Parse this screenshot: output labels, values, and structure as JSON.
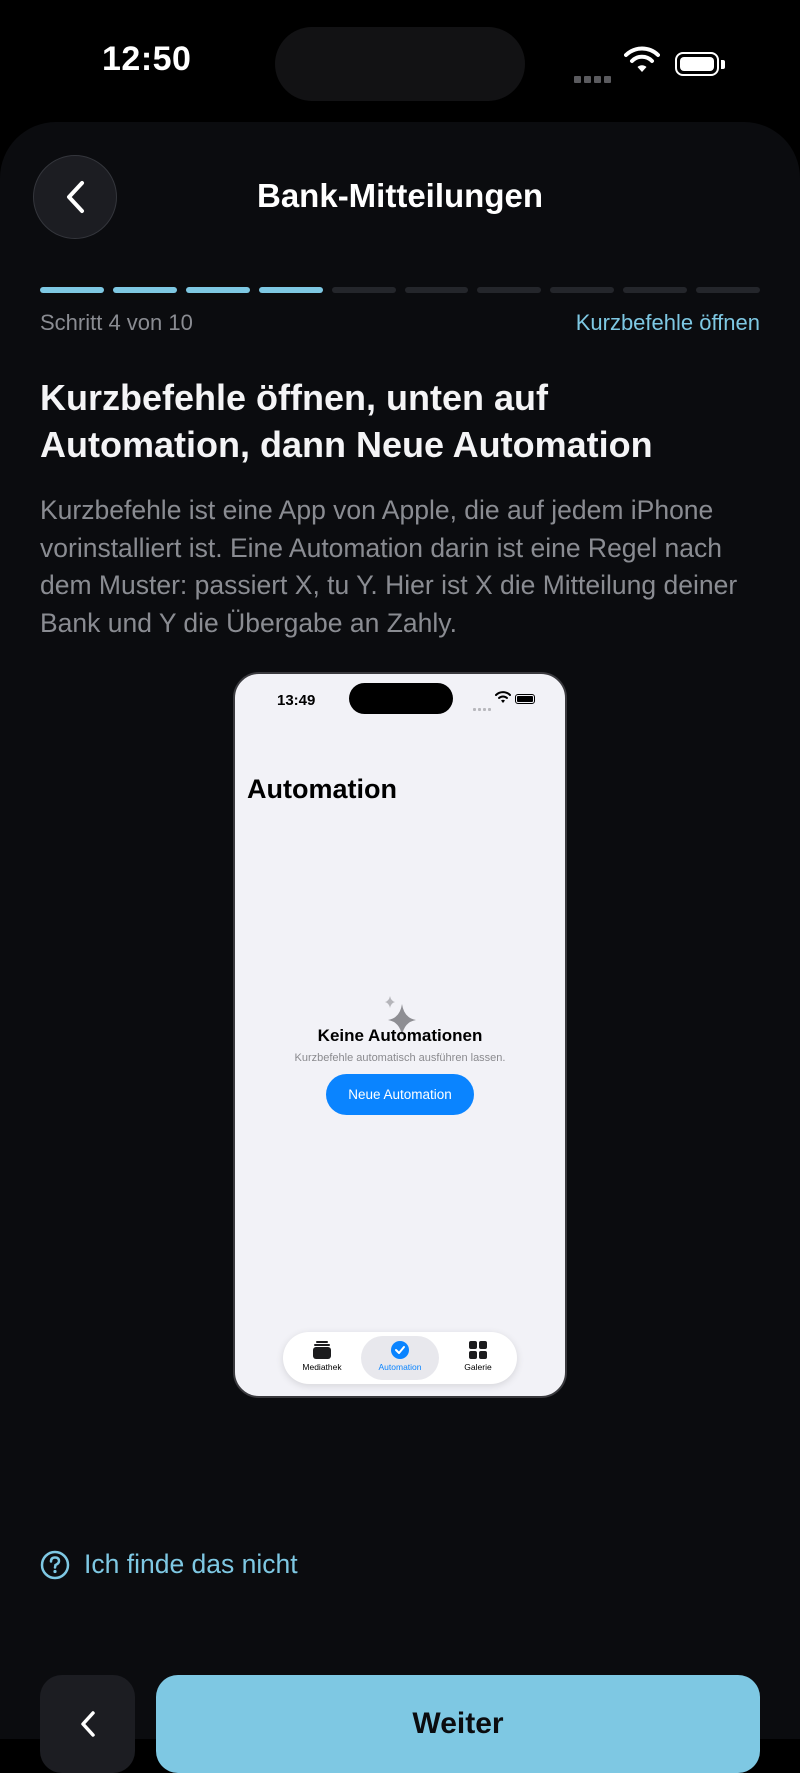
{
  "status_bar": {
    "time": "12:50"
  },
  "header": {
    "title": "Bank-Mitteilungen"
  },
  "progress": {
    "current_step": 4,
    "total_steps": 10,
    "step_label": "Schritt 4 von 10",
    "hint": "Kurzbefehle öffnen"
  },
  "content": {
    "headline": "Kurzbefehle öffnen, unten auf Automation, dann Neue Automation",
    "description": "Kurzbefehle ist eine App von Apple, die auf jedem iPhone vorinstalliert ist. Eine Automation darin ist eine Regel nach dem Muster: passiert X, tu Y. Hier ist X die Mitteilung deiner Bank und Y die Übergabe an Zahly."
  },
  "illustration": {
    "time": "13:49",
    "title": "Automation",
    "empty_title": "Keine Automationen",
    "empty_subtitle": "Kurzbefehle automatisch ausführen lassen.",
    "new_button": "Neue Automation",
    "tabs": [
      {
        "label": "Mediathek",
        "icon": "stack-icon"
      },
      {
        "label": "Automation",
        "icon": "clock-check-icon"
      },
      {
        "label": "Galerie",
        "icon": "grid-icon"
      }
    ],
    "active_tab": "Automation"
  },
  "help_link": "Ich finde das nicht",
  "footer": {
    "next_label": "Weiter"
  },
  "colors": {
    "accent": "#7ec8e3",
    "background": "#0b0c0f",
    "ios_blue": "#0a84ff"
  }
}
